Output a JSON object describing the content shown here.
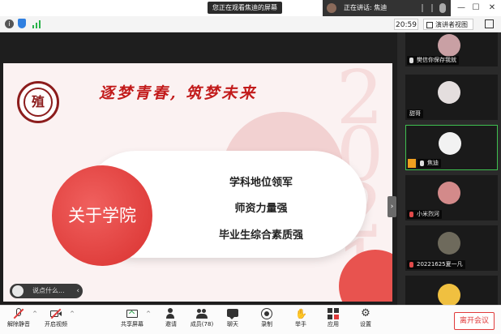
{
  "titlebar": {
    "viewing_label": "您正在观看焦迪的屏幕",
    "speaking_label": "正在讲话: 焦迪"
  },
  "infobar": {
    "time": "20:59",
    "view_label": "演讲者视图"
  },
  "slide": {
    "title": "逐梦青春, 筑梦未来",
    "watermark": "2021",
    "logo_text": "殖",
    "about_label": "关于学院",
    "items": [
      "学科地位领军",
      "师资力量强",
      "毕业生综合素质强"
    ],
    "comment_placeholder": "说点什么...",
    "colors": {
      "accent": "#d9312f",
      "title": "#c21b1b"
    }
  },
  "gallery": {
    "tiles": [
      {
        "name": "樊信你保存我就",
        "mic": "normal",
        "avatar_color": "#c9a0a4"
      },
      {
        "name": "甜哥",
        "mic": "none",
        "avatar_color": "#e4dede"
      },
      {
        "name": "焦迪",
        "mic": "normal",
        "avatar_color": "#f2f2f2",
        "active": true,
        "sharing": true
      },
      {
        "name": "小米烈河",
        "mic": "muted",
        "avatar_color": "#d38a8a"
      },
      {
        "name": "20221625夏一凡",
        "mic": "muted",
        "avatar_color": "#6e6a5c"
      },
      {
        "name": "",
        "mic": "none",
        "avatar_color": "#f0c040"
      }
    ]
  },
  "toolbar": {
    "mute_label": "解除静音",
    "video_label": "开启视频",
    "share_label": "共享屏幕",
    "invite_label": "邀请",
    "members_label": "成员(78)",
    "chat_label": "聊天",
    "record_label": "录制",
    "hand_label": "举手",
    "apps_label": "应用",
    "settings_label": "设置",
    "leave_label": "离开会议"
  }
}
